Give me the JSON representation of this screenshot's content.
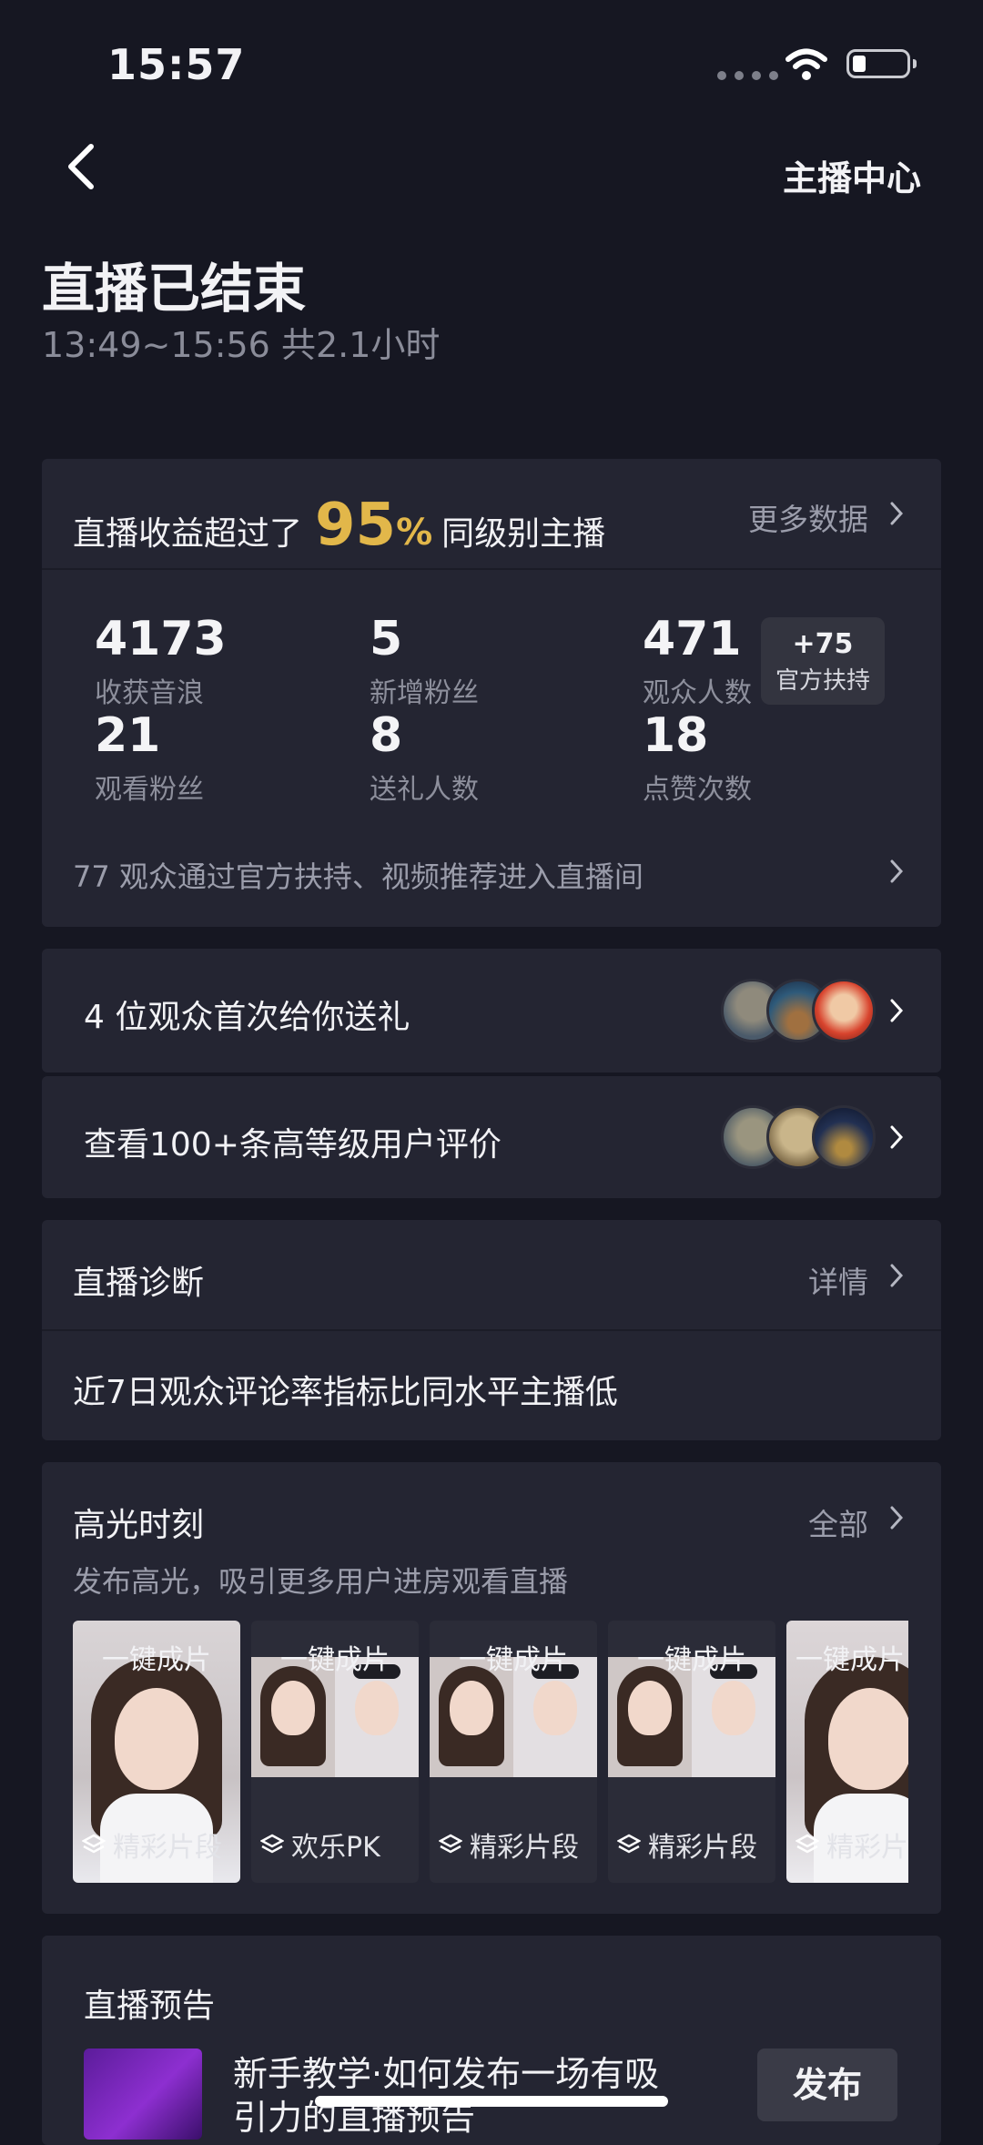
{
  "status_bar": {
    "time": "15:57"
  },
  "header": {
    "back_icon": "chevron-left-icon",
    "center_link": "主播中心"
  },
  "page": {
    "title": "直播已结束",
    "subtitle": "13:49~15:56 共2.1小时"
  },
  "revenue_card": {
    "prefix": "直播收益超过了",
    "percent_number": "95",
    "percent_sign": "%",
    "suffix": "同级别主播",
    "more_link": "更多数据",
    "stats": [
      {
        "value": "4173",
        "label": "收获音浪"
      },
      {
        "value": "5",
        "label": "新增粉丝"
      },
      {
        "value": "471",
        "label": "观众人数"
      },
      {
        "value": "21",
        "label": "观看粉丝"
      },
      {
        "value": "8",
        "label": "送礼人数"
      },
      {
        "value": "18",
        "label": "点赞次数"
      }
    ],
    "boost_badge": {
      "value": "+75",
      "label": "官方扶持"
    },
    "footer": "77 观众通过官方扶持、视频推荐进入直播间"
  },
  "gift_row": {
    "text": "4 位观众首次给你送礼"
  },
  "review_row": {
    "text": "查看100+条高等级用户评价"
  },
  "diagnosis": {
    "title": "直播诊断",
    "detail_link": "详情",
    "message": "近7日观众评论率指标比同水平主播低"
  },
  "highlights": {
    "title": "高光时刻",
    "all_link": "全部",
    "subtitle": "发布高光，吸引更多用户进房观看直播",
    "items": [
      {
        "top_label": "一键成片",
        "bottom_label": "精彩片段"
      },
      {
        "top_label": "一键成片",
        "bottom_label": "欢乐PK"
      },
      {
        "top_label": "一键成片",
        "bottom_label": "精彩片段"
      },
      {
        "top_label": "一键成片",
        "bottom_label": "精彩片段"
      },
      {
        "top_label": "一键成片",
        "bottom_label": "精彩片"
      }
    ]
  },
  "preview": {
    "title": "直播预告",
    "text_line1": "新手教学·如何发布一场有吸",
    "text_line2": "引力的直播预告",
    "publish_button": "发布"
  },
  "colors": {
    "background": "#161722",
    "card": "#242532",
    "accent_gold": "#e2b74a",
    "muted_text": "#9b9dab"
  }
}
